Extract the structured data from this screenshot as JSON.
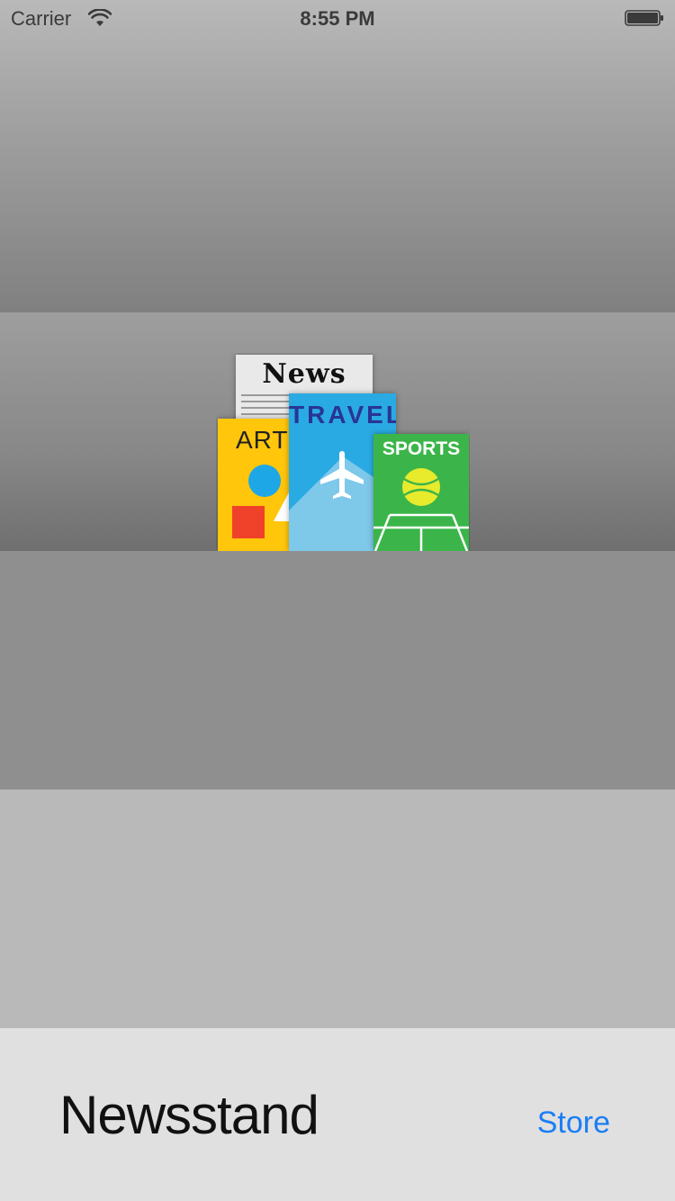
{
  "status_bar": {
    "carrier": "Carrier",
    "time": "8:55 PM",
    "wifi_icon": "wifi-icon",
    "battery_icon": "battery-icon"
  },
  "newsstand": {
    "magazines": [
      {
        "name": "News",
        "cover_color": "#e9e9e9"
      },
      {
        "name": "ART",
        "cover_color": "#ffc60b"
      },
      {
        "name": "TRAVEL",
        "cover_color": "#2aaae3"
      },
      {
        "name": "SPORTS",
        "cover_color": "#3bb54a"
      }
    ]
  },
  "bottom_bar": {
    "title": "Newsstand",
    "store_label": "Store",
    "accent_color": "#1a7ef5"
  }
}
